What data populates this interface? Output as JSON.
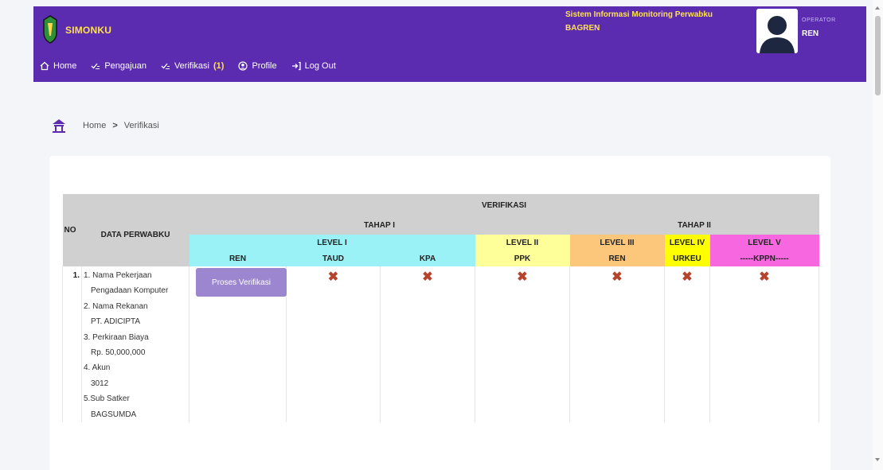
{
  "brand": {
    "name": "SIMONKU"
  },
  "system": {
    "title": "Sistem Informasi Monitoring Perwabku",
    "subtitle": "BAGREN"
  },
  "user": {
    "role": "OPERATOR",
    "name": "REN"
  },
  "nav": [
    {
      "icon": "house-icon",
      "label": "Home"
    },
    {
      "icon": "checklist-icon",
      "label": "Pengajuan"
    },
    {
      "icon": "checklist-icon",
      "label": "Verifikasi"
    },
    {
      "icon": "user-circle-icon",
      "label": "Profile"
    },
    {
      "icon": "logout-icon",
      "label": "Log Out"
    }
  ],
  "nav_badge": "(1)",
  "breadcrumb": {
    "home": "Home",
    "separator": ">",
    "current": "Verifikasi"
  },
  "table": {
    "headers": {
      "no": "NO",
      "data": "DATA PERWABKU",
      "verifikasi": "VERIFIKASI",
      "tahap1": "TAHAP I",
      "tahap2": "TAHAP II",
      "level1": "LEVEL I",
      "level2": "LEVEL II",
      "level3": "LEVEL III",
      "level4": "LEVEL IV",
      "level5": "LEVEL V",
      "ren": "REN",
      "taud": "TAUD",
      "kpa": "KPA",
      "ppk": "PPK",
      "ren2": "REN",
      "urkeu": "URKEU",
      "kppn": "-----KPPN-----"
    },
    "rows": [
      {
        "no": "1.",
        "details": [
          {
            "label": "1. Nama Pekerjaan",
            "value": "Pengadaan Komputer"
          },
          {
            "label": "2. Nama Rekanan",
            "value": "PT. ADICIPTA"
          },
          {
            "label": "3. Perkiraan Biaya",
            "value": "Rp. 50,000,000"
          },
          {
            "label": "4. Akun",
            "value": "3012"
          },
          {
            "label": "5.Sub Satker",
            "value": "BAGSUMDA"
          }
        ],
        "action": "Proses Verifikasi",
        "status": [
          "✖",
          "✖",
          "✖",
          "✖",
          "✖",
          "✖"
        ]
      }
    ]
  },
  "colors": {
    "topbar": "#5b2cb0",
    "accent_yellow": "#ffe14d",
    "level1": "#9af2f6",
    "level2": "#ffff99",
    "level3": "#fdc77b",
    "level4": "#ffff00",
    "level5": "#f768e0",
    "button": "#9b86cf",
    "xmark": "#b5442e"
  }
}
